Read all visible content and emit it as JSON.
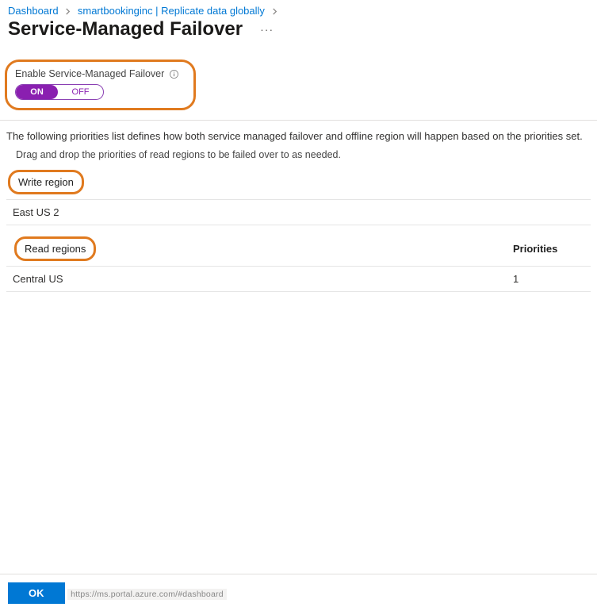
{
  "breadcrumb": {
    "items": [
      {
        "label": "Dashboard"
      },
      {
        "label": "smartbookinginc | Replicate data globally"
      }
    ]
  },
  "page": {
    "title": "Service-Managed Failover",
    "more": "···"
  },
  "enable": {
    "label": "Enable Service-Managed Failover",
    "on": "ON",
    "off": "OFF",
    "state": "on"
  },
  "text": {
    "description": "The following priorities list defines how both service managed failover and offline region will happen based on the priorities set.",
    "subdescription": "Drag and drop the priorities of read regions to be failed over to as needed."
  },
  "write": {
    "header": "Write region",
    "rows": [
      {
        "name": "East US 2"
      }
    ]
  },
  "read": {
    "header": "Read regions",
    "priorities_header": "Priorities",
    "rows": [
      {
        "name": "Central US",
        "priority": "1"
      }
    ]
  },
  "footer": {
    "ok": "OK",
    "status": "https://ms.portal.azure.com/#dashboard"
  }
}
